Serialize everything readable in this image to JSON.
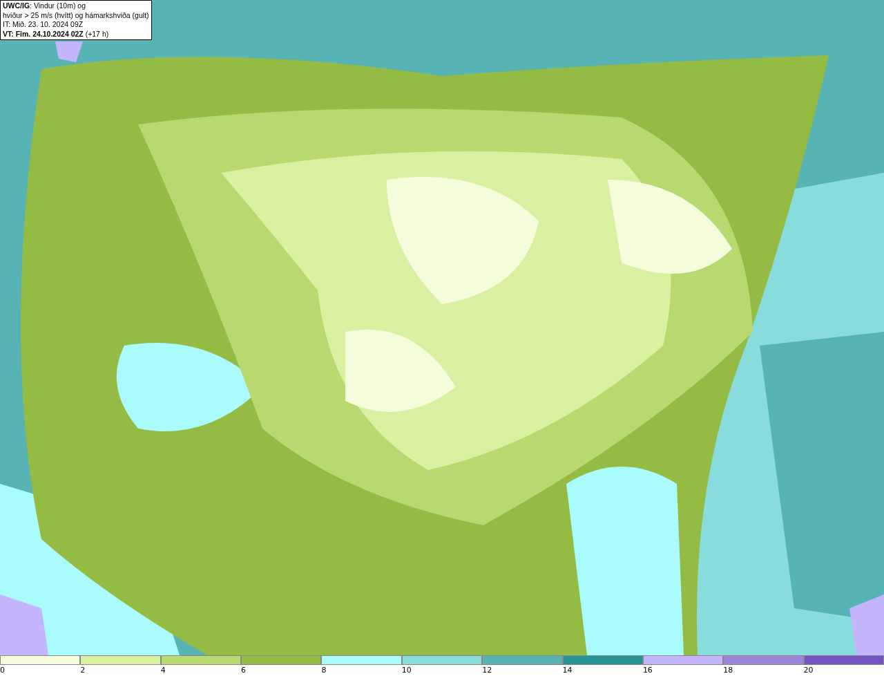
{
  "title_box": {
    "lines": [
      "**UWC/IG**: Vindur (10m) og",
      "hviður > 25 m/s (hvítt) og hámarkshviða (gult)",
      "IT: Mið. 23. 10. 2024 09Z",
      "**VT: Fim. 24.10.2024 02Z** (+17 h)"
    ]
  },
  "legend": {
    "bins": [
      {
        "label": "0",
        "color": "#f5fcdc"
      },
      {
        "label": "2",
        "color": "#d9f0a0"
      },
      {
        "label": "4",
        "color": "#b8d870"
      },
      {
        "label": "6",
        "color": "#94bc44"
      },
      {
        "label": "8",
        "color": "#aafcfc"
      },
      {
        "label": "10",
        "color": "#88dcdc"
      },
      {
        "label": "12",
        "color": "#58b4b4"
      },
      {
        "label": "14",
        "color": "#289494"
      },
      {
        "label": "16",
        "color": "#c4b4fc"
      },
      {
        "label": "18",
        "color": "#9c84dc"
      },
      {
        "label": "20",
        "color": "#7454c4"
      }
    ]
  }
}
